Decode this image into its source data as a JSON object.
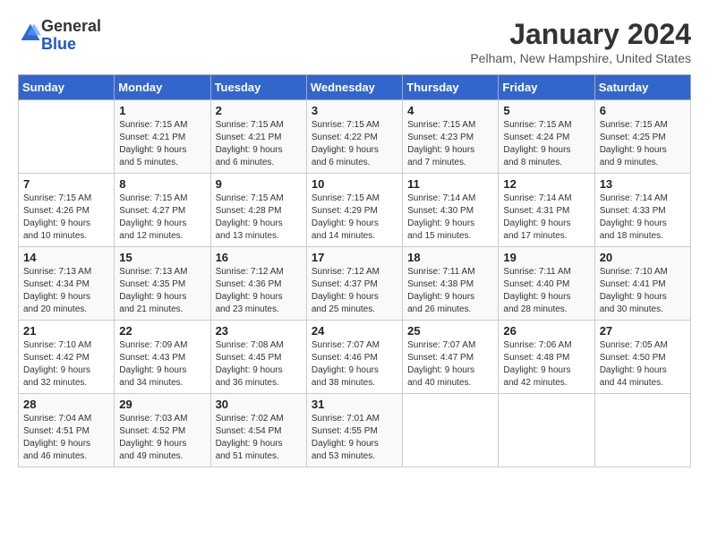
{
  "logo": {
    "general": "General",
    "blue": "Blue"
  },
  "title": "January 2024",
  "location": "Pelham, New Hampshire, United States",
  "headers": [
    "Sunday",
    "Monday",
    "Tuesday",
    "Wednesday",
    "Thursday",
    "Friday",
    "Saturday"
  ],
  "weeks": [
    [
      {
        "day": "",
        "info": ""
      },
      {
        "day": "1",
        "info": "Sunrise: 7:15 AM\nSunset: 4:21 PM\nDaylight: 9 hours\nand 5 minutes."
      },
      {
        "day": "2",
        "info": "Sunrise: 7:15 AM\nSunset: 4:21 PM\nDaylight: 9 hours\nand 6 minutes."
      },
      {
        "day": "3",
        "info": "Sunrise: 7:15 AM\nSunset: 4:22 PM\nDaylight: 9 hours\nand 6 minutes."
      },
      {
        "day": "4",
        "info": "Sunrise: 7:15 AM\nSunset: 4:23 PM\nDaylight: 9 hours\nand 7 minutes."
      },
      {
        "day": "5",
        "info": "Sunrise: 7:15 AM\nSunset: 4:24 PM\nDaylight: 9 hours\nand 8 minutes."
      },
      {
        "day": "6",
        "info": "Sunrise: 7:15 AM\nSunset: 4:25 PM\nDaylight: 9 hours\nand 9 minutes."
      }
    ],
    [
      {
        "day": "7",
        "info": "Sunrise: 7:15 AM\nSunset: 4:26 PM\nDaylight: 9 hours\nand 10 minutes."
      },
      {
        "day": "8",
        "info": "Sunrise: 7:15 AM\nSunset: 4:27 PM\nDaylight: 9 hours\nand 12 minutes."
      },
      {
        "day": "9",
        "info": "Sunrise: 7:15 AM\nSunset: 4:28 PM\nDaylight: 9 hours\nand 13 minutes."
      },
      {
        "day": "10",
        "info": "Sunrise: 7:15 AM\nSunset: 4:29 PM\nDaylight: 9 hours\nand 14 minutes."
      },
      {
        "day": "11",
        "info": "Sunrise: 7:14 AM\nSunset: 4:30 PM\nDaylight: 9 hours\nand 15 minutes."
      },
      {
        "day": "12",
        "info": "Sunrise: 7:14 AM\nSunset: 4:31 PM\nDaylight: 9 hours\nand 17 minutes."
      },
      {
        "day": "13",
        "info": "Sunrise: 7:14 AM\nSunset: 4:33 PM\nDaylight: 9 hours\nand 18 minutes."
      }
    ],
    [
      {
        "day": "14",
        "info": "Sunrise: 7:13 AM\nSunset: 4:34 PM\nDaylight: 9 hours\nand 20 minutes."
      },
      {
        "day": "15",
        "info": "Sunrise: 7:13 AM\nSunset: 4:35 PM\nDaylight: 9 hours\nand 21 minutes."
      },
      {
        "day": "16",
        "info": "Sunrise: 7:12 AM\nSunset: 4:36 PM\nDaylight: 9 hours\nand 23 minutes."
      },
      {
        "day": "17",
        "info": "Sunrise: 7:12 AM\nSunset: 4:37 PM\nDaylight: 9 hours\nand 25 minutes."
      },
      {
        "day": "18",
        "info": "Sunrise: 7:11 AM\nSunset: 4:38 PM\nDaylight: 9 hours\nand 26 minutes."
      },
      {
        "day": "19",
        "info": "Sunrise: 7:11 AM\nSunset: 4:40 PM\nDaylight: 9 hours\nand 28 minutes."
      },
      {
        "day": "20",
        "info": "Sunrise: 7:10 AM\nSunset: 4:41 PM\nDaylight: 9 hours\nand 30 minutes."
      }
    ],
    [
      {
        "day": "21",
        "info": "Sunrise: 7:10 AM\nSunset: 4:42 PM\nDaylight: 9 hours\nand 32 minutes."
      },
      {
        "day": "22",
        "info": "Sunrise: 7:09 AM\nSunset: 4:43 PM\nDaylight: 9 hours\nand 34 minutes."
      },
      {
        "day": "23",
        "info": "Sunrise: 7:08 AM\nSunset: 4:45 PM\nDaylight: 9 hours\nand 36 minutes."
      },
      {
        "day": "24",
        "info": "Sunrise: 7:07 AM\nSunset: 4:46 PM\nDaylight: 9 hours\nand 38 minutes."
      },
      {
        "day": "25",
        "info": "Sunrise: 7:07 AM\nSunset: 4:47 PM\nDaylight: 9 hours\nand 40 minutes."
      },
      {
        "day": "26",
        "info": "Sunrise: 7:06 AM\nSunset: 4:48 PM\nDaylight: 9 hours\nand 42 minutes."
      },
      {
        "day": "27",
        "info": "Sunrise: 7:05 AM\nSunset: 4:50 PM\nDaylight: 9 hours\nand 44 minutes."
      }
    ],
    [
      {
        "day": "28",
        "info": "Sunrise: 7:04 AM\nSunset: 4:51 PM\nDaylight: 9 hours\nand 46 minutes."
      },
      {
        "day": "29",
        "info": "Sunrise: 7:03 AM\nSunset: 4:52 PM\nDaylight: 9 hours\nand 49 minutes."
      },
      {
        "day": "30",
        "info": "Sunrise: 7:02 AM\nSunset: 4:54 PM\nDaylight: 9 hours\nand 51 minutes."
      },
      {
        "day": "31",
        "info": "Sunrise: 7:01 AM\nSunset: 4:55 PM\nDaylight: 9 hours\nand 53 minutes."
      },
      {
        "day": "",
        "info": ""
      },
      {
        "day": "",
        "info": ""
      },
      {
        "day": "",
        "info": ""
      }
    ]
  ]
}
